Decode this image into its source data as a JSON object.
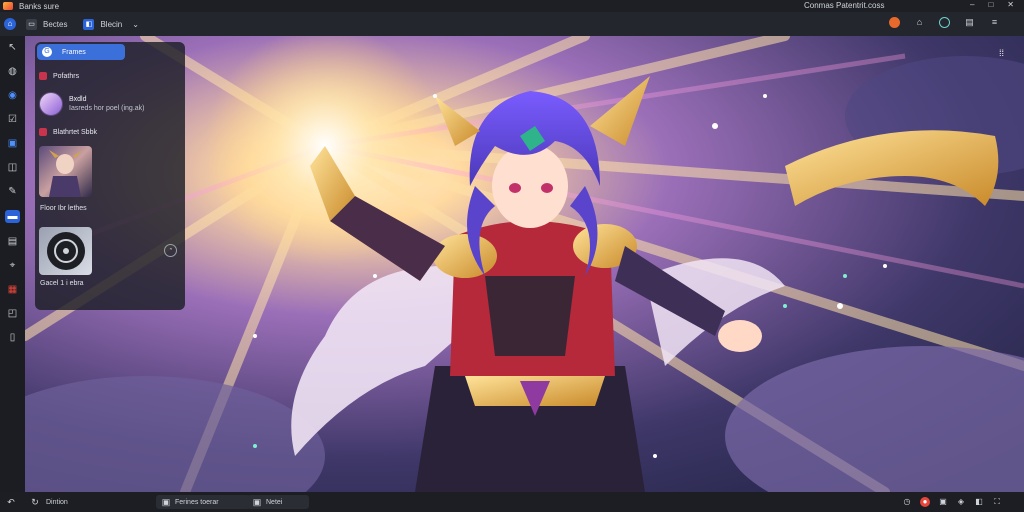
{
  "titlebar": {
    "app_name": "Banks sure",
    "doc_title": "Conmas Patentrit.coss",
    "window_buttons": [
      "minimize-icon",
      "restore-icon",
      "close-icon"
    ]
  },
  "tabbar": {
    "tabs": [
      {
        "label": "Bectes",
        "icon": "browser-tab-icon"
      },
      {
        "label": "Blecin",
        "icon": "blue-tab-icon"
      }
    ],
    "right_icons": [
      "firefox-icon",
      "home-icon",
      "globe-icon",
      "notes-icon",
      "menu-icon"
    ]
  },
  "leftrail": {
    "items": [
      "cursor-icon",
      "grid-icon",
      "globe-icon",
      "checkbox-icon",
      "image-icon",
      "camera-icon",
      "pen-icon",
      "chat-icon",
      "list-icon",
      "pin-icon",
      "alert-icon",
      "bag-icon",
      "doc-icon"
    ]
  },
  "panel": {
    "search_label": "Frames",
    "section1": "Pofathrs",
    "profile": {
      "name": "Bxdld",
      "subtitle": "Iasreds hor poel (ing.ak)"
    },
    "section2": "Blathrtet Sbbk",
    "thumb1_caption": "Floor Ibr lethes",
    "thumb2_caption": "Gacel 1 i ebra"
  },
  "statusbar": {
    "left_label": "Dintion",
    "box1_label": "Ferines toerar",
    "box2_label": "Netei",
    "right_icons": [
      "clock-icon",
      "record-icon",
      "save-icon",
      "share-icon",
      "split-icon",
      "fullscreen-icon"
    ]
  },
  "colors": {
    "accent": "#2b63d8",
    "titlebar": "#1d1f24",
    "toolbar": "#23262c",
    "rail": "#1b1d22"
  }
}
